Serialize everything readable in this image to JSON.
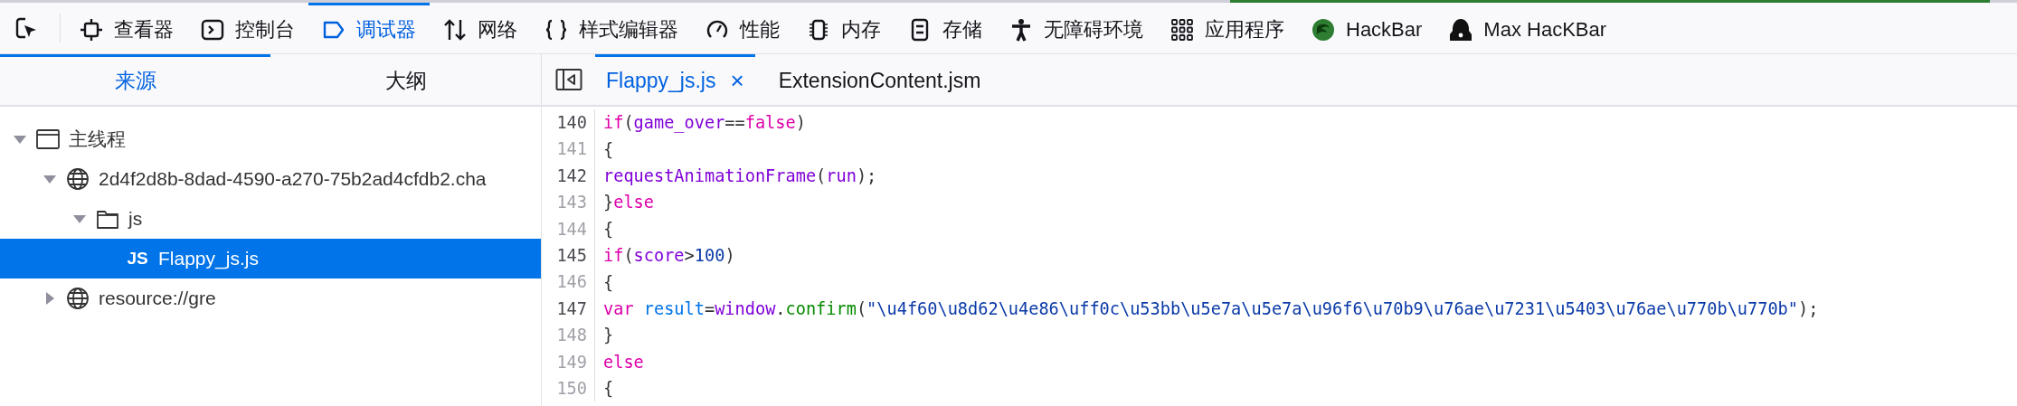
{
  "toolbar": {
    "tabs": [
      {
        "label": "查看器",
        "selected": false
      },
      {
        "label": "控制台",
        "selected": false
      },
      {
        "label": "调试器",
        "selected": true
      },
      {
        "label": "网络",
        "selected": false
      },
      {
        "label": "样式编辑器",
        "selected": false
      },
      {
        "label": "性能",
        "selected": false
      },
      {
        "label": "内存",
        "selected": false
      },
      {
        "label": "存储",
        "selected": false
      },
      {
        "label": "无障碍环境",
        "selected": false
      },
      {
        "label": "应用程序",
        "selected": false
      },
      {
        "label": "HackBar",
        "selected": false
      },
      {
        "label": "Max HacKBar",
        "selected": false
      }
    ]
  },
  "sidebar": {
    "tabs": [
      {
        "label": "来源",
        "selected": true
      },
      {
        "label": "大纲",
        "selected": false
      }
    ],
    "tree": [
      {
        "kind": "thread",
        "label": "主线程",
        "expanded": true,
        "selected": false,
        "children": [
          {
            "kind": "host",
            "label": "2d4f2d8b-8dad-4590-a270-75b2ad4cfdb2.cha",
            "expanded": true,
            "selected": false,
            "children": [
              {
                "kind": "folder",
                "label": "js",
                "expanded": true,
                "selected": false,
                "children": [
                  {
                    "kind": "file",
                    "badge": "JS",
                    "label": "Flappy_js.js",
                    "selected": true
                  }
                ]
              }
            ]
          },
          {
            "kind": "host",
            "label": "resource://gre",
            "expanded": false,
            "selected": false
          }
        ]
      }
    ]
  },
  "editor": {
    "tabs": [
      {
        "label": "Flappy_js.js",
        "close": "×",
        "selected": true
      },
      {
        "label": "ExtensionContent.jsm",
        "selected": false
      }
    ],
    "lines": [
      {
        "number": "140",
        "breakable": true,
        "tokens": [
          {
            "kind": "keyword",
            "text": "if"
          },
          {
            "kind": "plain",
            "text": "("
          },
          {
            "kind": "variable",
            "text": "game_over"
          },
          {
            "kind": "plain",
            "text": "=="
          },
          {
            "kind": "keyword",
            "text": "false"
          },
          {
            "kind": "plain",
            "text": ")"
          }
        ]
      },
      {
        "number": "141",
        "breakable": false,
        "tokens": [
          {
            "kind": "plain",
            "text": "{"
          }
        ]
      },
      {
        "number": "142",
        "breakable": true,
        "tokens": [
          {
            "kind": "variable",
            "text": "requestAnimationFrame"
          },
          {
            "kind": "plain",
            "text": "("
          },
          {
            "kind": "variable",
            "text": "run"
          },
          {
            "kind": "plain",
            "text": ");"
          }
        ]
      },
      {
        "number": "143",
        "breakable": false,
        "tokens": [
          {
            "kind": "plain",
            "text": "}"
          },
          {
            "kind": "keyword",
            "text": "else"
          }
        ]
      },
      {
        "number": "144",
        "breakable": false,
        "tokens": [
          {
            "kind": "plain",
            "text": "{"
          }
        ]
      },
      {
        "number": "145",
        "breakable": true,
        "tokens": [
          {
            "kind": "keyword",
            "text": "if"
          },
          {
            "kind": "plain",
            "text": "("
          },
          {
            "kind": "variable",
            "text": "score"
          },
          {
            "kind": "plain",
            "text": ">"
          },
          {
            "kind": "number",
            "text": "100"
          },
          {
            "kind": "plain",
            "text": ")"
          }
        ]
      },
      {
        "number": "146",
        "breakable": false,
        "tokens": [
          {
            "kind": "plain",
            "text": "{"
          }
        ]
      },
      {
        "number": "147",
        "breakable": true,
        "tokens": [
          {
            "kind": "keyword",
            "text": "var "
          },
          {
            "kind": "definition",
            "text": "result"
          },
          {
            "kind": "plain",
            "text": "="
          },
          {
            "kind": "variable",
            "text": "window"
          },
          {
            "kind": "plain",
            "text": "."
          },
          {
            "kind": "method",
            "text": "confirm"
          },
          {
            "kind": "plain",
            "text": "("
          },
          {
            "kind": "string",
            "text": "\"\\u4f60\\u8d62\\u4e86\\uff0c\\u53bb\\u5e7a\\u5e7a\\u96f6\\u70b9\\u76ae\\u7231\\u5403\\u76ae\\u770b\\u770b\""
          },
          {
            "kind": "plain",
            "text": ");"
          }
        ]
      },
      {
        "number": "148",
        "breakable": false,
        "tokens": [
          {
            "kind": "plain",
            "text": "}"
          }
        ]
      },
      {
        "number": "149",
        "breakable": false,
        "tokens": [
          {
            "kind": "keyword",
            "text": "else"
          }
        ]
      },
      {
        "number": "150",
        "breakable": false,
        "tokens": [
          {
            "kind": "plain",
            "text": "{"
          }
        ]
      }
    ]
  }
}
